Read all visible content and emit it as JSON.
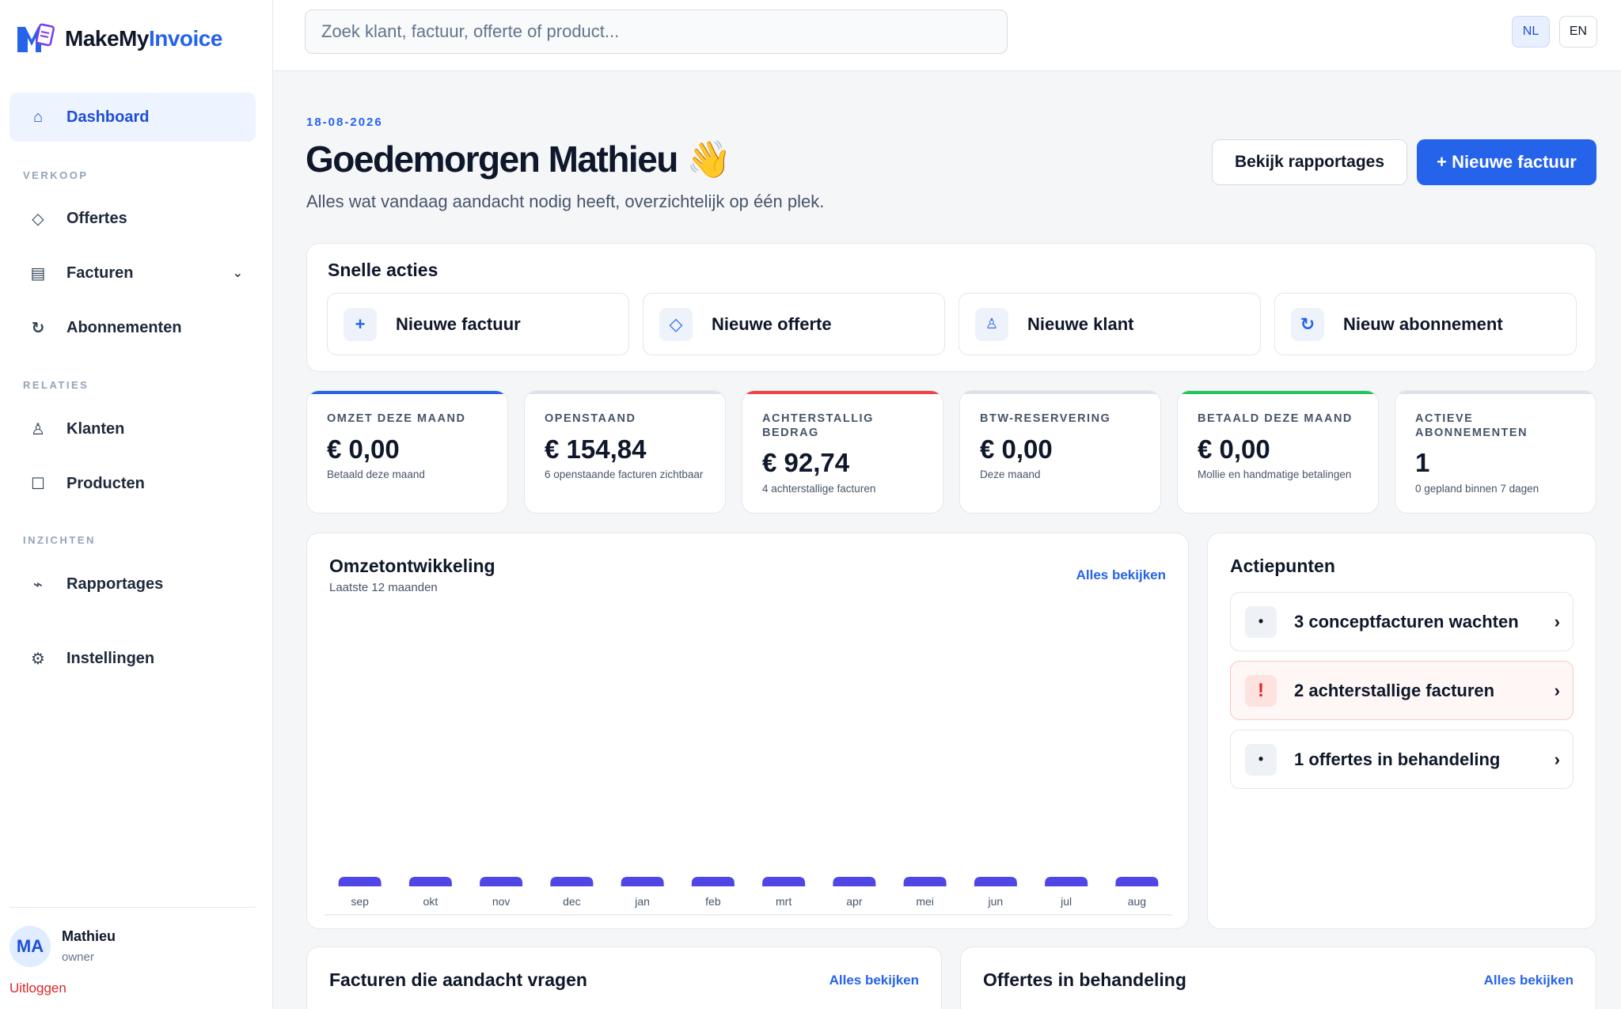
{
  "brand": {
    "name_part1": "MakeMy",
    "name_part2": "Invoice"
  },
  "search": {
    "placeholder": "Zoek klant, factuur, offerte of product..."
  },
  "languages": [
    "NL",
    "EN"
  ],
  "sidebar": {
    "dashboard": "Dashboard",
    "sections": {
      "sales": "VERKOOP",
      "relations": "RELATIES",
      "insights": "INZICHTEN"
    },
    "items": {
      "quotes": "Offertes",
      "invoices": "Facturen",
      "subscriptions": "Abonnementen",
      "customers": "Klanten",
      "products": "Producten",
      "reports": "Rapportages",
      "settings": "Instellingen"
    },
    "user": {
      "initials": "MA",
      "name": "Mathieu",
      "role": "owner",
      "logout": "Uitloggen"
    }
  },
  "header": {
    "date": "18-08-2026",
    "greeting": "Goedemorgen Mathieu 👋",
    "subtitle": "Alles wat vandaag aandacht nodig heeft, overzichtelijk op één plek.",
    "reports_button": "Bekijk rapportages",
    "new_invoice_button": "+ Nieuwe factuur"
  },
  "quick_actions": {
    "title": "Snelle acties",
    "items": [
      "Nieuwe factuur",
      "Nieuwe offerte",
      "Nieuwe klant",
      "Nieuw abonnement"
    ]
  },
  "kpis": [
    {
      "label": "OMZET DEZE MAAND",
      "value": "€ 0,00",
      "sub": "Betaald deze maand",
      "accent": "#2563eb"
    },
    {
      "label": "OPENSTAAND",
      "value": "€ 154,84",
      "sub": "6 openstaande facturen zichtbaar",
      "accent": "#dde2e8"
    },
    {
      "label": "ACHTERSTALLIG BEDRAG",
      "value": "€ 92,74",
      "sub": "4 achterstallige facturen",
      "accent": "#ef4444"
    },
    {
      "label": "BTW-RESERVERING",
      "value": "€ 0,00",
      "sub": "Deze maand",
      "accent": "#dde2e8"
    },
    {
      "label": "BETAALD DEZE MAAND",
      "value": "€ 0,00",
      "sub": "Mollie en handmatige betalingen",
      "accent": "#22c55e"
    },
    {
      "label": "ACTIEVE ABONNEMENTEN",
      "value": "1",
      "sub": "0 gepland binnen 7 dagen",
      "accent": "#dde2e8"
    }
  ],
  "revenue": {
    "title": "Omzetontwikkeling",
    "subtitle": "Laatste 12 maanden",
    "link": "Alles bekijken"
  },
  "chart_data": {
    "type": "bar",
    "categories": [
      "sep",
      "okt",
      "nov",
      "dec",
      "jan",
      "feb",
      "mrt",
      "apr",
      "mei",
      "jun",
      "jul",
      "aug"
    ],
    "values": [
      0,
      0,
      0,
      0,
      0,
      0,
      0,
      0,
      0,
      0,
      0,
      0
    ],
    "title": "Omzetontwikkeling",
    "xlabel": "",
    "ylabel": "",
    "bar_color": "#4f46e5",
    "grid": false
  },
  "action_points": {
    "title": "Actiepunten",
    "items": [
      {
        "icon": "•",
        "text": "3 conceptfacturen wachten"
      },
      {
        "icon": "!",
        "text": "2 achterstallige facturen"
      },
      {
        "icon": "•",
        "text": "1 offertes in behandeling"
      }
    ],
    "chevron": "›"
  },
  "attention_invoices": {
    "title": "Facturen die aandacht vragen",
    "link": "Alles bekijken"
  },
  "pending_quotes": {
    "title": "Offertes in behandeling",
    "link": "Alles bekijken"
  },
  "colors": {
    "primary": "#2563eb",
    "danger": "#dc2626",
    "success": "#22c55e",
    "chart_bar": "#4f46e5"
  }
}
